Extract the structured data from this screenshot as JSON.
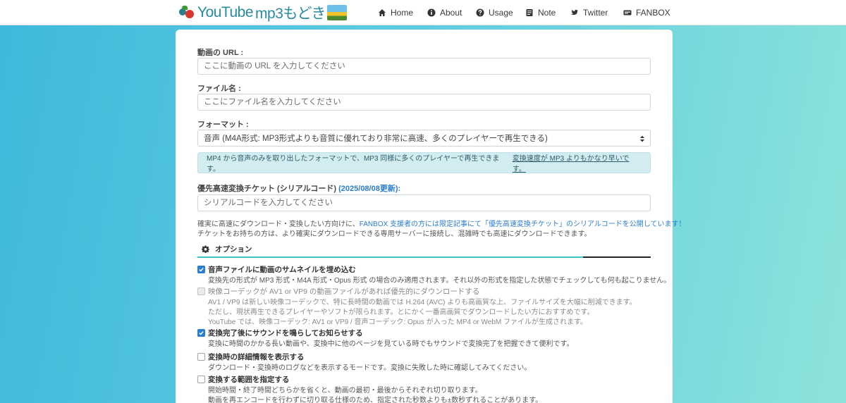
{
  "header": {
    "logo_text_a": "YouTube",
    "logo_text_b": "mp3もどき",
    "nav": [
      {
        "label": "Home",
        "icon": "home-icon"
      },
      {
        "label": "About",
        "icon": "info-icon"
      },
      {
        "label": "Usage",
        "icon": "question-icon"
      },
      {
        "label": "Note",
        "icon": "note-icon"
      },
      {
        "label": "Twitter",
        "icon": "twitter-icon"
      },
      {
        "label": "FANBOX",
        "icon": "fanbox-icon"
      }
    ]
  },
  "form": {
    "url_label": "動画の URL :",
    "url_placeholder": "ここに動画の URL を入力してください",
    "filename_label": "ファイル名 :",
    "filename_placeholder": "ここにファイル名を入力してください",
    "format_label": "フォーマット :",
    "format_selected": "音声 (M4A形式: MP3形式よりも音質に優れており非常に高速、多くのプレイヤーで再生できる)",
    "info_text": "MP4 から音声のみを取り出したフォーマットで、MP3 同様に多くのプレイヤーで再生できます。",
    "info_link": "変換速度が MP3 よりもかなり早いです。",
    "ticket_label": "優先高速変換チケット (シリアルコード)",
    "ticket_date": "(2025/08/08更新):",
    "ticket_placeholder": "シリアルコードを入力してください",
    "note1_a": "確実に高速にダウンロード・変換したい方向けに、",
    "note1_b": "FANBOX 支援者の方には限定記事にて「優先高速変換チケット」のシリアルコードを公開しています！",
    "note2": "チケットをお持ちの方は、より確実にダウンロードできる専用サーバーに接続し、混雑時でも高速にダウンロードできます。"
  },
  "options": {
    "title": "オプション",
    "items": [
      {
        "label": "音声ファイルに動画のサムネイルを埋め込む",
        "checked": true,
        "disabled": false,
        "desc": [
          "変換先の形式が MP3 形式・M4A 形式・Opus 形式 の場合のみ適用されます。それ以外の形式を指定した状態でチェックしても何も起こりません。"
        ]
      },
      {
        "label": "映像コーデックが AV1 or VP9 の動画ファイルがあれば優先的にダウンロードする",
        "checked": false,
        "disabled": true,
        "desc": [
          "AV1 / VP9 は新しい映像コーデックで、特に長時間の動画では H.264 (AVC) よりも高画質な上、ファイルサイズを大幅に削減できます。",
          "ただし、現状再生できるプレイヤーやソフトが限られます。とにかく一番高画質でダウンロードしたい方におすすめです。",
          "YouTube では、映像コーデック: AV1 or VP9 / 音声コーデック: Opus が入った MP4 or WebM ファイルが生成されます。"
        ]
      },
      {
        "label": "変換完了後にサウンドを鳴らしてお知らせする",
        "checked": true,
        "disabled": false,
        "desc": [
          "変換に時間のかかる長い動画や、変換中に他のページを見ている時でもサウンドで変換完了を把握できて便利です。"
        ]
      },
      {
        "label": "変換時の詳細情報を表示する",
        "checked": false,
        "disabled": false,
        "desc": [
          "ダウンロード・変換時のログなどを表示するモードです。変換に失敗した時に確認してみてください。"
        ]
      },
      {
        "label": "変換する範囲を指定する",
        "checked": false,
        "disabled": false,
        "desc": [
          "開始時間・終了時間どちらかを省くと、動画の最初・最後からそれぞれ切り取ります。",
          "動画を再エンコードを行わずに切り取る仕様のため、指定された秒数よりも±数秒ずれることがあります。"
        ]
      }
    ]
  },
  "colors": {
    "accent": "#2b7dd0",
    "teal": "#3ec5c6",
    "info_bg": "#d3ecf0"
  }
}
